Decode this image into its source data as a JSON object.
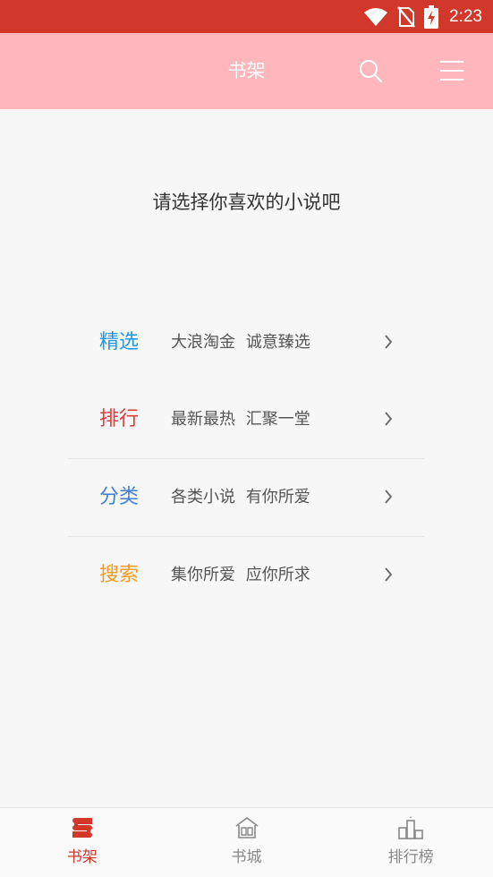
{
  "status_bar": {
    "time": "2:23",
    "icons": [
      "wifi-icon",
      "no-sim-icon",
      "battery-charging-icon"
    ]
  },
  "header": {
    "title": "书架",
    "actions": [
      "search-icon",
      "menu-icon"
    ]
  },
  "prompt": "请选择你喜欢的小说吧",
  "menu": {
    "items": [
      {
        "title": "精选",
        "desc": "大浪淘金 诚意臻选",
        "color": "#2296e0"
      },
      {
        "title": "排行",
        "desc": "最新最热 汇聚一堂",
        "color": "#e03a3a"
      },
      {
        "title": "分类",
        "desc": "各类小说 有你所爱",
        "color": "#3f7fd6"
      },
      {
        "title": "搜索",
        "desc": "集你所爱 应你所求",
        "color": "#f59a23"
      }
    ]
  },
  "tabs": [
    {
      "label": "书架",
      "icon": "bookshelf-icon",
      "active": true
    },
    {
      "label": "书城",
      "icon": "bookstore-icon",
      "active": false
    },
    {
      "label": "排行榜",
      "icon": "ranking-icon",
      "active": false
    }
  ],
  "colors": {
    "status_bar": "#d2382a",
    "app_bar": "#ffb6bd",
    "active_tab": "#d2382a"
  }
}
